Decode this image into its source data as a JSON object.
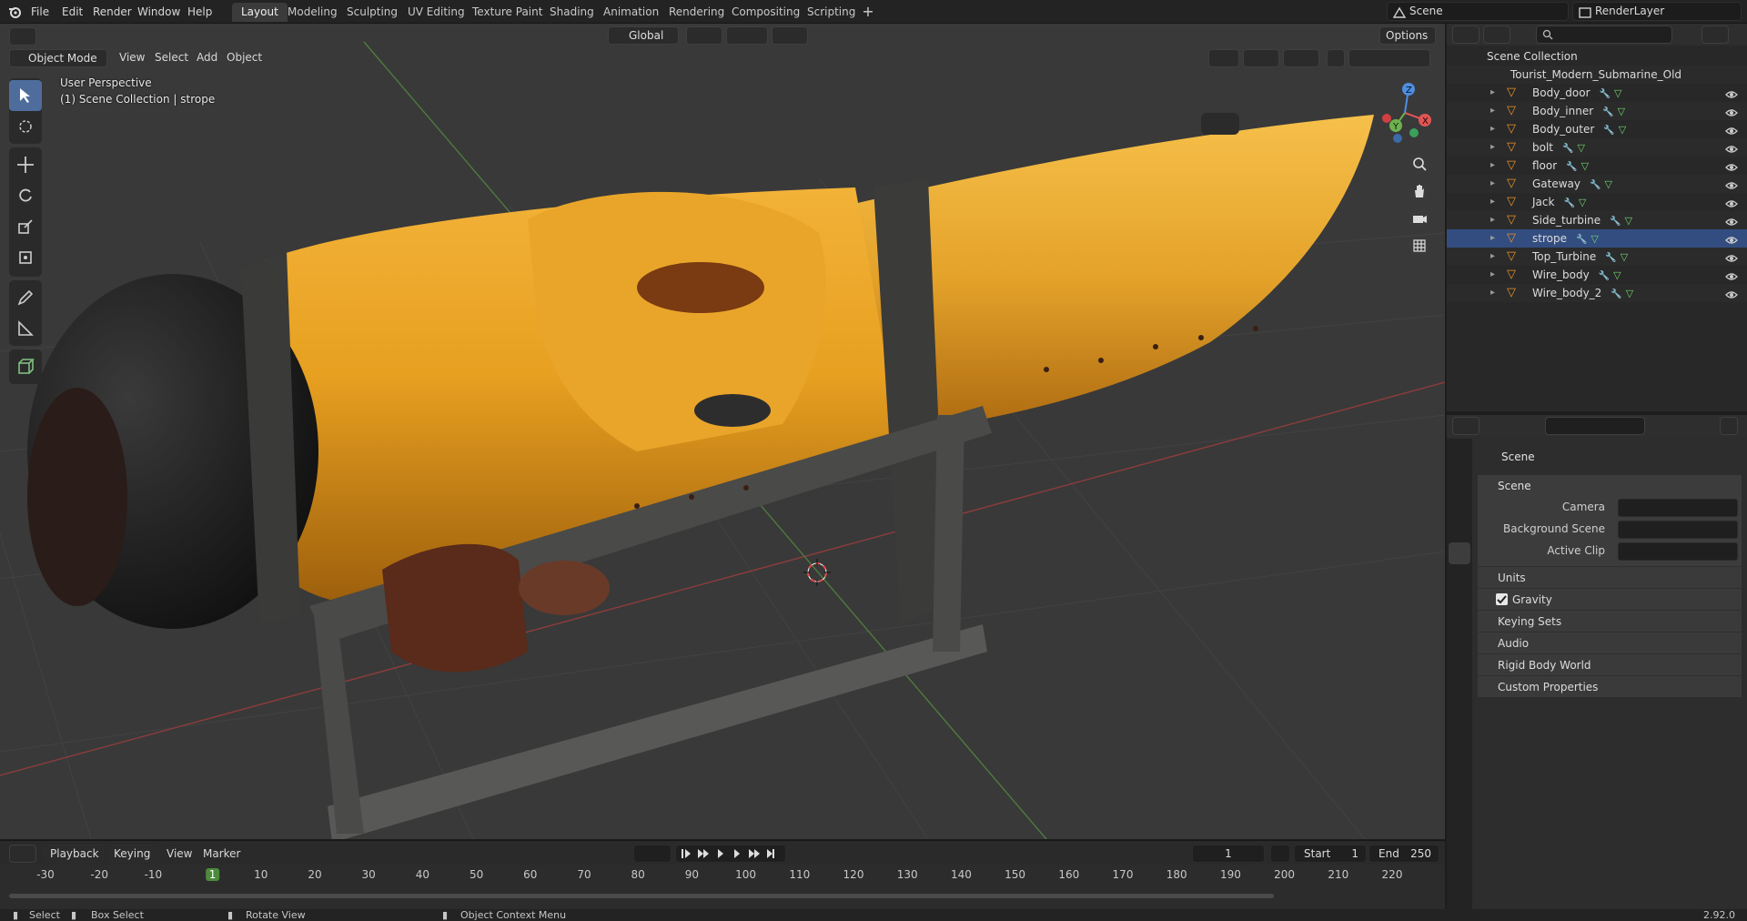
{
  "topbar": {
    "menus": [
      "File",
      "Edit",
      "Render",
      "Window",
      "Help"
    ],
    "workspaces": [
      "Layout",
      "Modeling",
      "Sculpting",
      "UV Editing",
      "Texture Paint",
      "Shading",
      "Animation",
      "Rendering",
      "Compositing",
      "Scripting"
    ],
    "active_workspace": "Layout",
    "scene": "Scene",
    "view_layer": "RenderLayer"
  },
  "viewport": {
    "mode": "Object Mode",
    "menus": [
      "View",
      "Select",
      "Add",
      "Object"
    ],
    "orientation": "Global",
    "options_label": "Options",
    "perspective_label": "User Perspective",
    "collection_label": "(1) Scene Collection | strope",
    "gizmo": {
      "x": "X",
      "y": "Y",
      "z": "Z"
    }
  },
  "outliner": {
    "root": "Scene Collection",
    "collection": "Tourist_Modern_Submarine_Old",
    "objects": [
      "Body_door",
      "Body_inner",
      "Body_outer",
      "bolt",
      "floor",
      "Gateway",
      "Jack",
      "Side_turbine",
      "strope",
      "Top_Turbine",
      "Wire_body",
      "Wire_body_2"
    ],
    "selected": "strope"
  },
  "properties": {
    "context": "Scene",
    "panel": "Scene",
    "fields": [
      "Camera",
      "Background Scene",
      "Active Clip"
    ],
    "subpanels": [
      "Units",
      "Gravity",
      "Keying Sets",
      "Audio",
      "Rigid Body World",
      "Custom Properties"
    ],
    "gravity_checked": true
  },
  "timeline": {
    "menus": [
      "Playback",
      "Keying",
      "View",
      "Marker"
    ],
    "current_frame": "1",
    "start_label": "Start",
    "start": "1",
    "end_label": "End",
    "end": "250",
    "ticks": [
      "-30",
      "-20",
      "-10",
      "1",
      "10",
      "20",
      "30",
      "40",
      "50",
      "60",
      "70",
      "80",
      "90",
      "100",
      "110",
      "120",
      "130",
      "140",
      "150",
      "160",
      "170",
      "180",
      "190",
      "200",
      "210",
      "220"
    ]
  },
  "statusbar": {
    "select": "Select",
    "box_select": "Box Select",
    "rotate": "Rotate View",
    "context_menu": "Object Context Menu",
    "version": "2.92.0"
  }
}
